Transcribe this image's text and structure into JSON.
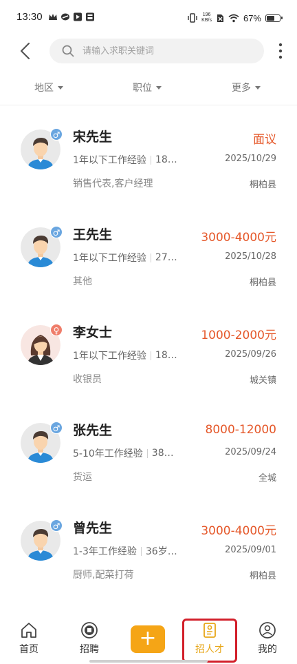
{
  "status_bar": {
    "time": "13:30",
    "net_speed_value": "196",
    "net_speed_unit": "KB/s",
    "battery": "67%",
    "battery_level": 0.67
  },
  "search": {
    "placeholder": "请输入求职关键词"
  },
  "filters": [
    {
      "label": "地区"
    },
    {
      "label": "职位"
    },
    {
      "label": "更多"
    }
  ],
  "candidates": [
    {
      "name": "宋先生",
      "gender": "male",
      "gender_symbol": "♂",
      "salary": "面议",
      "experience": "1年以下工作经验",
      "age": "18…",
      "date": "2025/10/29",
      "position": "销售代表,客户经理",
      "location": "桐柏县"
    },
    {
      "name": "王先生",
      "gender": "male",
      "gender_symbol": "♂",
      "salary": "3000-4000元",
      "experience": "1年以下工作经验",
      "age": "27…",
      "date": "2025/10/28",
      "position": "其他",
      "location": "桐柏县"
    },
    {
      "name": "李女士",
      "gender": "female",
      "gender_symbol": "♀",
      "salary": "1000-2000元",
      "experience": "1年以下工作经验",
      "age": "18…",
      "date": "2025/09/26",
      "position": "收银员",
      "location": "城关镇"
    },
    {
      "name": "张先生",
      "gender": "male",
      "gender_symbol": "♂",
      "salary": "8000-12000",
      "experience": "5-10年工作经验",
      "age": "38…",
      "date": "2025/09/24",
      "position": "货运",
      "location": "全城"
    },
    {
      "name": "曾先生",
      "gender": "male",
      "gender_symbol": "♂",
      "salary": "3000-4000元",
      "experience": "1-3年工作经验",
      "age": "36岁…",
      "date": "2025/09/01",
      "position": "厨师,配菜打荷",
      "location": "桐柏县"
    }
  ],
  "bottom_nav": {
    "home": "首页",
    "jobs": "招聘",
    "post": "+",
    "talent": "招人才",
    "mine": "我的",
    "active": "talent"
  },
  "colors": {
    "accent": "#f5a516",
    "salary": "#e5582a",
    "male_badge": "#6aa6e0",
    "female_badge": "#ef7d6a",
    "highlight": "#d21f2a"
  }
}
